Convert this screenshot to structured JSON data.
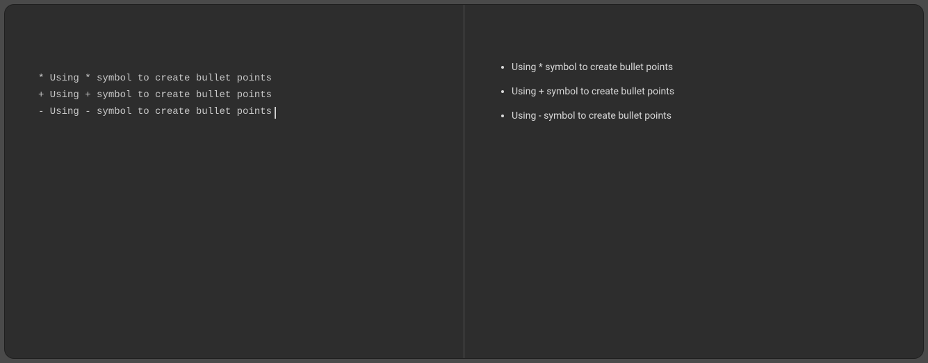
{
  "editor": {
    "lines": [
      "* Using * symbol to create bullet points",
      "+ Using + symbol to create bullet points",
      "- Using - symbol to create bullet points"
    ]
  },
  "preview": {
    "items": [
      "Using * symbol to create bullet points",
      "Using + symbol to create bullet points",
      "Using - symbol to create bullet points"
    ]
  }
}
